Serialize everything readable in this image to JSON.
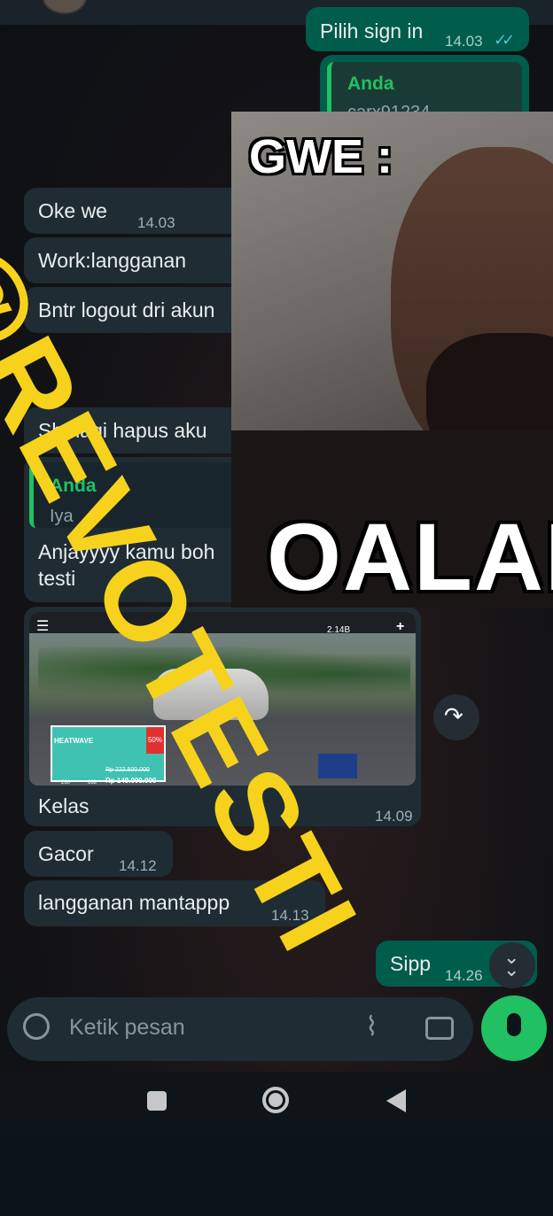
{
  "chat": {
    "partial_top": {
      "text": "Pilih sign in",
      "time": "14.03"
    },
    "reply_out": {
      "author": "Anda",
      "quote": "carx91234"
    },
    "messages": [
      {
        "text": "Oke we",
        "time": "14.03"
      },
      {
        "text": "Work:langganan"
      },
      {
        "text": "Bntr logout dri akun"
      },
      {
        "text": "Sbr lagi hapus aku"
      }
    ],
    "reply_in": {
      "author": "Anda",
      "quote": "Iya",
      "text_line1": "Anjayyyy kamu boh",
      "text_line2": "testi"
    },
    "image_msg": {
      "caption": "Kelas",
      "time": "14.09"
    },
    "gacor": {
      "text": "Gacor",
      "time": "14.12"
    },
    "mantap": {
      "text": "langganan mantappp",
      "time": "14.13"
    },
    "sipp": {
      "text": "Sipp",
      "time": "14.26"
    }
  },
  "game_screenshot": {
    "coins": "2.14B",
    "card_title": "HEATWAVE",
    "discount": "50%",
    "old_price": "Rp 222.500.000",
    "price": "Rp 149.000.000",
    "stat1": "260",
    "stat2": "668"
  },
  "meme": {
    "top_text": "GWE :",
    "bottom_text": "OALAH"
  },
  "watermark": "@REVOTESTI",
  "composer": {
    "placeholder": "Ketik pesan"
  },
  "icons": {
    "emoji": "emoji-icon",
    "attach": "paperclip-icon",
    "camera": "camera-icon",
    "mic": "microphone-icon",
    "forward": "forward-icon",
    "scroll": "double-chevron-down-icon",
    "nav_recent": "square-icon",
    "nav_home": "circle-icon",
    "nav_back": "triangle-back-icon"
  },
  "colors": {
    "incoming": "#1f2c34",
    "outgoing": "#005c4b",
    "accent": "#21c063",
    "watermark": "#f7d21c"
  }
}
